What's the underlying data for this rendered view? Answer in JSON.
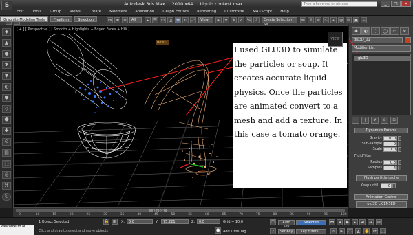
{
  "app": {
    "logo": "S",
    "title_parts": [
      "Autodesk 3ds Max",
      "2010 x64",
      "Liquid contest.max"
    ],
    "search_placeholder": "Type a keyword or phrase",
    "window_buttons": [
      "_",
      "□",
      "×"
    ]
  },
  "menu": {
    "items": [
      "Edit",
      "Tools",
      "Group",
      "Views",
      "Create",
      "Modifiers",
      "Animation",
      "Graph Editors",
      "Rendering",
      "Customize",
      "MAXScript",
      "Help"
    ]
  },
  "toolbar": {
    "ribbon_tabs": [
      "Graphite Modeling Tools",
      "Freeform",
      "Selection"
    ],
    "filter_dropdown": "All",
    "view_dropdown": "View",
    "selection_set": "Create Selection Se"
  },
  "viewport": {
    "label": "[ + ] [ Perspective ] [ Smooth + Highlights + Edged Faces + HW ]",
    "object_tag": "Box01",
    "viewcube_label": "VIEW",
    "annotation": "I used GLU3D to simulate the particles or soup.  It creates accurate liquid physics. Once the particles are animated convert to a mesh and add a texture. In this case a tomato orange.",
    "colors": {
      "wire_bowl": "#ffffff",
      "particles_blue": "#3b7bff",
      "particles_orange": "#f2b27a",
      "grid": "#6f6f6f",
      "pointer_line": "#ff2020"
    }
  },
  "command_panel": {
    "tabs": [
      "✱",
      "◐",
      "⬡",
      "◯",
      "▭",
      "⚒"
    ],
    "object_name": "glu3D_01",
    "object_color": "#c7431f",
    "modifier_list": "Modifier List",
    "stack_item": "glu3D",
    "stack_controls": [
      "⊣",
      "|",
      "∀",
      "⊘",
      "⊞"
    ],
    "dynamics_title": "Dynamics Params",
    "params": [
      {
        "label": "Gravity",
        "value": "10.0"
      },
      {
        "label": "Sub-sample",
        "value": "0"
      },
      {
        "label": "Scale",
        "value": "1.0"
      }
    ],
    "fluid_filter_label": "FluidFilter",
    "filter_params": [
      {
        "label": "Radius",
        "value": "0.3"
      },
      {
        "label": "Samples",
        "value": "4"
      }
    ],
    "flush_button": "Flush particle cache",
    "keep_until_label": "Keep until",
    "keep_until_value": "0",
    "animation_title": "Animation Control",
    "license_button": "glu3D LICENSED"
  },
  "timeline": {
    "frame_display": "43 / 100",
    "current_frame_fraction": 0.43,
    "ticks": [
      "0",
      "10",
      "15",
      "20",
      "25",
      "30",
      "35",
      "40",
      "45",
      "50",
      "55",
      "60",
      "65",
      "70",
      "75",
      "80",
      "85",
      "90",
      "95",
      "100"
    ]
  },
  "status": {
    "listener": "Welcome to M",
    "selection": "1 Object Selected",
    "prompt": "Click and drag to select and move objects",
    "x_label": "X:",
    "x_value": "0.0",
    "y_label": "Y:",
    "y_value": "75.221",
    "z_label": "Z:",
    "z_value": "0.0",
    "grid": "Grid = 10.0",
    "add_time_tag": "Add Time Tag",
    "auto_key": "Auto Key",
    "set_key": "Set Key",
    "selected": "Selected",
    "key_filters": "Key Filters..."
  }
}
